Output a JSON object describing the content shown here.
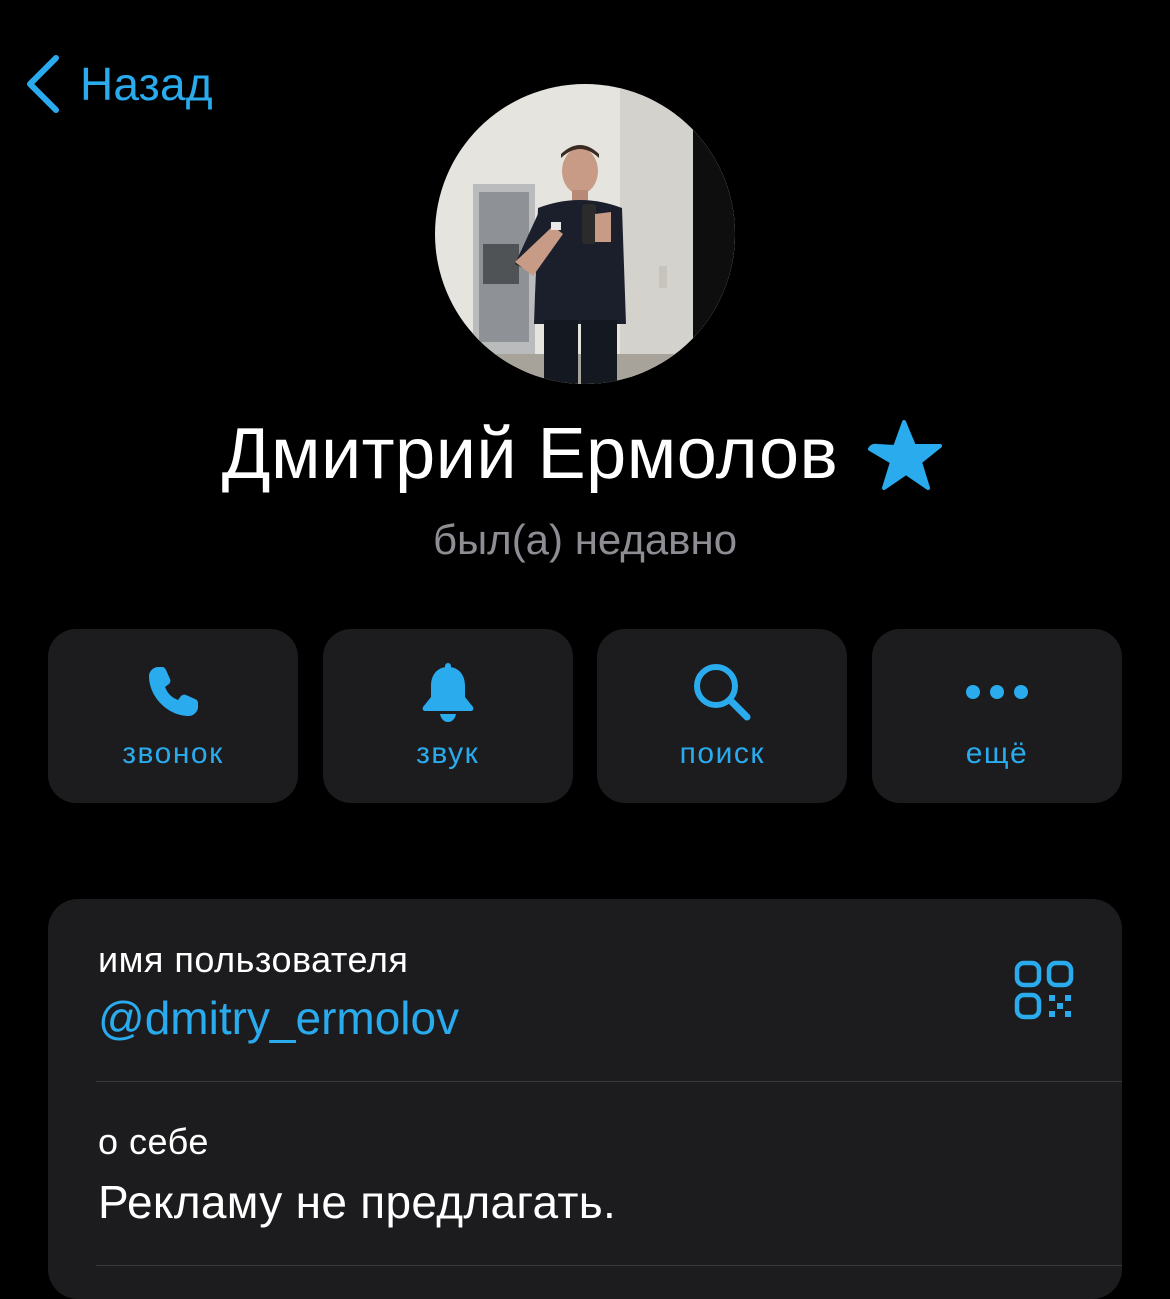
{
  "header": {
    "back_label": "Назад"
  },
  "profile": {
    "name": "Дмитрий Ермолов",
    "status": "был(а) недавно",
    "badge_icon": "star-badge-icon"
  },
  "actions": [
    {
      "label": "звонок",
      "icon": "phone-icon"
    },
    {
      "label": "звук",
      "icon": "bell-icon"
    },
    {
      "label": "поиск",
      "icon": "search-icon"
    },
    {
      "label": "ещё",
      "icon": "more-icon"
    }
  ],
  "info": {
    "username_label": "имя пользователя",
    "username_value": "@dmitry_ermolov",
    "bio_label": "о себе",
    "bio_value": "Рекламу не предлагать."
  },
  "colors": {
    "accent": "#2aabee",
    "background": "#000000",
    "card": "#1c1c1e",
    "secondary_text": "#8d8d93"
  }
}
